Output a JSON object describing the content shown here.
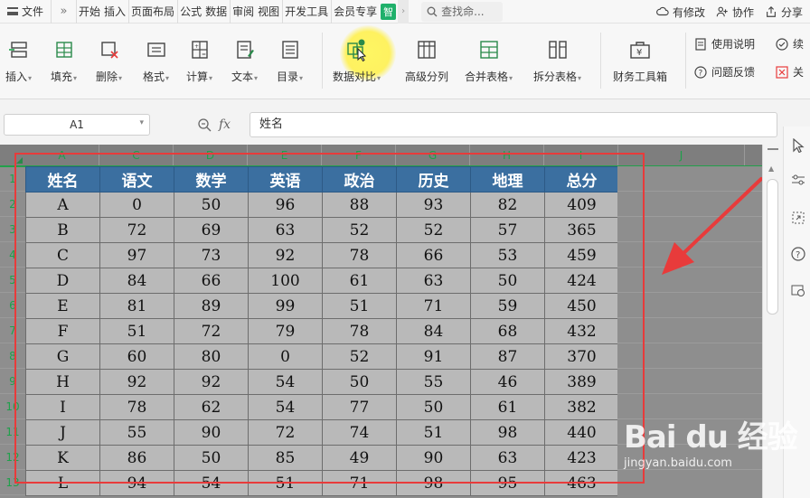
{
  "menubar": {
    "file_label": "文件",
    "more_label": "»",
    "tabs": [
      "开始",
      "插入",
      "页面布局",
      "公式",
      "数据",
      "审阅",
      "视图",
      "开发工具",
      "会员专享"
    ],
    "smart_label": "智",
    "search_placeholder": "查找命...",
    "has_changes_label": "有修改",
    "collab_label": "协作",
    "share_label": "分享"
  },
  "ribbon": {
    "buttons": [
      {
        "label": "插入",
        "icon": "insert-table-icon"
      },
      {
        "label": "填充",
        "icon": "fill-icon"
      },
      {
        "label": "删除",
        "icon": "delete-table-icon"
      },
      {
        "label": "格式",
        "icon": "format-icon"
      },
      {
        "label": "计算",
        "icon": "calculate-icon"
      },
      {
        "label": "文本",
        "icon": "text-icon"
      },
      {
        "label": "目录",
        "icon": "catalog-icon"
      },
      {
        "label": "数据对比",
        "icon": "data-compare-icon"
      },
      {
        "label": "高级分列",
        "icon": "advanced-split-icon"
      },
      {
        "label": "合并表格",
        "icon": "merge-table-icon"
      },
      {
        "label": "拆分表格",
        "icon": "split-table-icon"
      },
      {
        "label": "财务工具箱",
        "icon": "finance-toolbox-icon"
      }
    ],
    "usage_label": "使用说明",
    "feedback_label": "问题反馈",
    "continue_label": "续",
    "close_label": "关"
  },
  "formula": {
    "cell_ref": "A1",
    "fx": "fx",
    "value": "姓名"
  },
  "columns": [
    "A",
    "C",
    "D",
    "E",
    "F",
    "G",
    "H",
    "I",
    "J"
  ],
  "rows": [
    "1",
    "2",
    "3",
    "4",
    "5",
    "6",
    "7",
    "8",
    "9",
    "10",
    "11",
    "12",
    "13"
  ],
  "table": {
    "headers": [
      "姓名",
      "语文",
      "数学",
      "英语",
      "政治",
      "历史",
      "地理",
      "总分"
    ],
    "rows": [
      [
        "A",
        "0",
        "50",
        "96",
        "88",
        "93",
        "82",
        "409"
      ],
      [
        "B",
        "72",
        "69",
        "63",
        "52",
        "52",
        "57",
        "365"
      ],
      [
        "C",
        "97",
        "73",
        "92",
        "78",
        "66",
        "53",
        "459"
      ],
      [
        "D",
        "84",
        "66",
        "100",
        "61",
        "63",
        "50",
        "424"
      ],
      [
        "E",
        "81",
        "89",
        "99",
        "51",
        "71",
        "59",
        "450"
      ],
      [
        "F",
        "51",
        "72",
        "79",
        "78",
        "84",
        "68",
        "432"
      ],
      [
        "G",
        "60",
        "80",
        "0",
        "52",
        "91",
        "87",
        "370"
      ],
      [
        "H",
        "92",
        "92",
        "54",
        "50",
        "55",
        "46",
        "389"
      ],
      [
        "I",
        "78",
        "62",
        "54",
        "77",
        "50",
        "61",
        "382"
      ],
      [
        "J",
        "55",
        "90",
        "72",
        "74",
        "51",
        "98",
        "440"
      ],
      [
        "K",
        "86",
        "50",
        "85",
        "49",
        "90",
        "63",
        "423"
      ],
      [
        "L",
        "94",
        "54",
        "51",
        "71",
        "98",
        "95",
        "463"
      ]
    ]
  },
  "watermark": {
    "logo": "Bai du 经验",
    "url": "jingyan.baidu.com"
  },
  "colors": {
    "header_blue": "#3b6fa0",
    "accent_green": "#1ea04a",
    "highlight_red": "#e83b3b"
  }
}
